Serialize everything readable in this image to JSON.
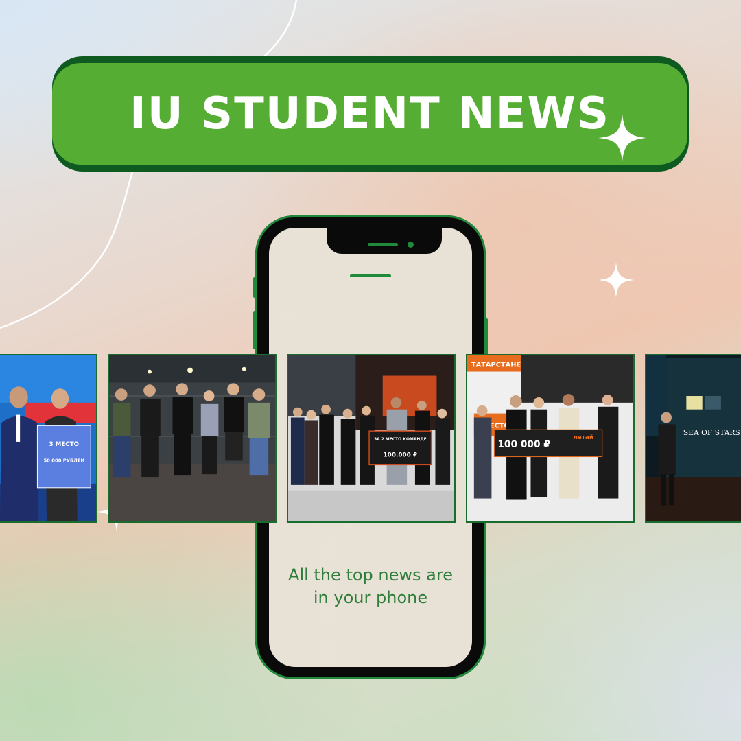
{
  "banner": {
    "title": "IU STUDENT NEWS"
  },
  "phone": {
    "caption_line1": "All the top news are",
    "caption_line2": "in your phone"
  },
  "photos": [
    {
      "id": "award-3rd-place",
      "sign_text": "3 МЕСТО",
      "sign_subtext": "50 000 РУБЛЕЙ"
    },
    {
      "id": "team-night-group",
      "sign_text": ""
    },
    {
      "id": "kiber-battle-2nd-place",
      "sign_text": "ЗА 2 МЕСТО КОМАНДЕ",
      "sign_subtext": "100.000 ₽"
    },
    {
      "id": "tatarstan-2nd-place",
      "sign_text": "100 000 ₽",
      "header_text": "ТАТАРСТАНЕ",
      "badge_text": "2 МЕСТО",
      "brand_text": "летай"
    },
    {
      "id": "sea-of-stars-presentation",
      "sign_text": "SEA OF STARS"
    }
  ],
  "colors": {
    "banner_green": "#55ad34",
    "banner_shadow": "#0f5a21",
    "phone_accent": "#1e8a3a",
    "caption": "#2e7d3a"
  }
}
